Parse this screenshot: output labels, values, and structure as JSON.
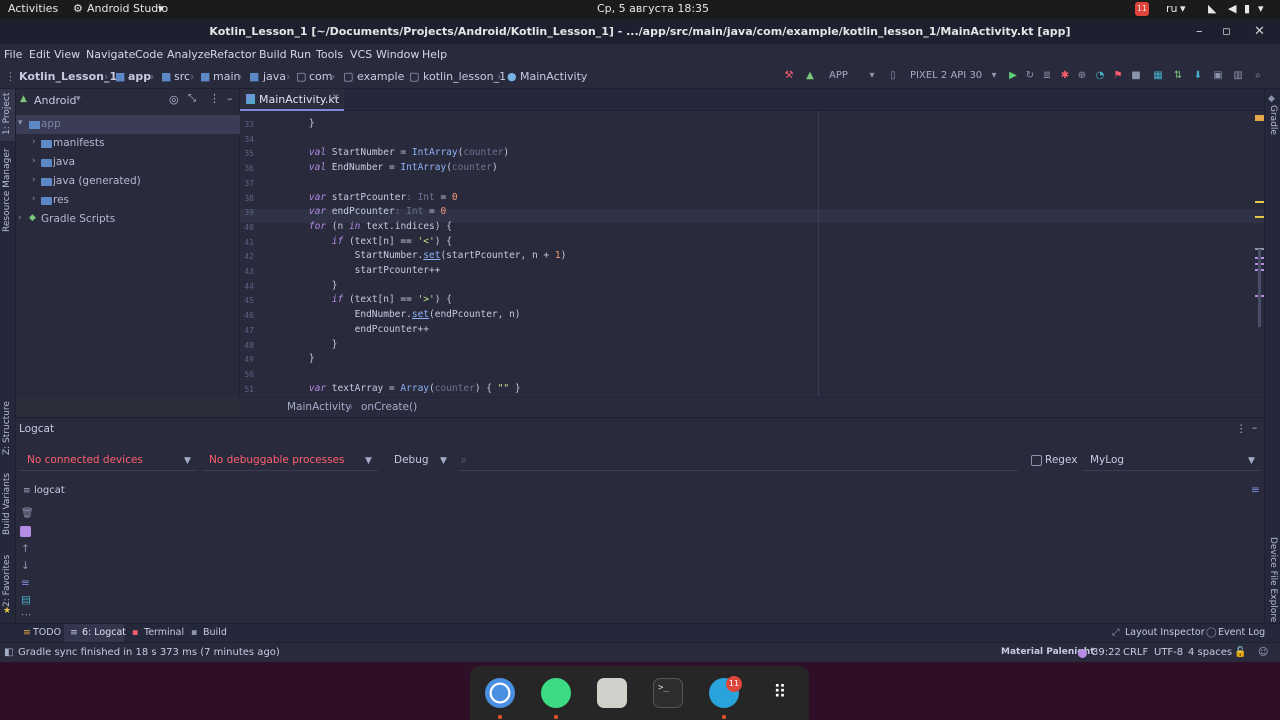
{
  "topbar": {
    "activities": "Activities",
    "app_name": "Android Studio",
    "clock": "Ср, 5 августа  18:35",
    "lang": "ru",
    "notif_count": "11"
  },
  "window": {
    "title": "Kotlin_Lesson_1 [~/Documents/Projects/Android/Kotlin_Lesson_1] - .../app/src/main/java/com/example/kotlin_lesson_1/MainActivity.kt [app]"
  },
  "menu": [
    "File",
    "Edit",
    "View",
    "Navigate",
    "Code",
    "Analyze",
    "Refactor",
    "Build",
    "Run",
    "Tools",
    "VCS",
    "Window",
    "Help"
  ],
  "breadcrumb": {
    "items": [
      "Kotlin_Lesson_1",
      "app",
      "src",
      "main",
      "java",
      "com",
      "example",
      "kotlin_lesson_1",
      "MainActivity"
    ]
  },
  "toolbar": {
    "config": "APP",
    "device": "PIXEL 2 API 30"
  },
  "project": {
    "view_mode": "Android",
    "tree": [
      {
        "label": "app"
      },
      {
        "label": "manifests"
      },
      {
        "label": "java"
      },
      {
        "label": "java (generated)"
      },
      {
        "label": "res"
      },
      {
        "label": "Gradle Scripts"
      }
    ]
  },
  "left_strip": {
    "project": "1: Project",
    "resource_manager": "Resource Manager",
    "structure": "Z: Structure",
    "build_variants": "Build Variants",
    "favorites": "2: Favorites"
  },
  "right_strip": {
    "gradle": "Gradle",
    "device_file_explorer": "Device File Explorer"
  },
  "editor": {
    "tab": "MainActivity.kt",
    "line_numbers": [
      "33",
      "34",
      "35",
      "36",
      "37",
      "38",
      "39",
      "40",
      "41",
      "42",
      "43",
      "44",
      "45",
      "46",
      "47",
      "48",
      "49",
      "50",
      "51"
    ],
    "lines": [
      {
        "t": "    }"
      },
      {
        "t": ""
      },
      {
        "t": "    val StartNumber = IntArray(counter)"
      },
      {
        "t": "    val EndNumber = IntArray(counter)"
      },
      {
        "t": ""
      },
      {
        "t": "    var startPcounter: Int = 0"
      },
      {
        "t": "    var endPcounter: Int = 0"
      },
      {
        "t": "    for (n in text.indices) {"
      },
      {
        "t": "        if (text[n] == '<') {"
      },
      {
        "t": "            StartNumber.set(startPcounter, n + 1)"
      },
      {
        "t": "            startPcounter++"
      },
      {
        "t": "        }"
      },
      {
        "t": "        if (text[n] == '>') {"
      },
      {
        "t": "            EndNumber.set(endPcounter, n)"
      },
      {
        "t": "            endPcounter++"
      },
      {
        "t": "        }"
      },
      {
        "t": "    }"
      },
      {
        "t": ""
      },
      {
        "t": "    var textArray = Array(counter) { \"\" }"
      }
    ],
    "crumb_class": "MainActivity",
    "crumb_method": "onCreate()"
  },
  "logcat": {
    "title": "Logcat",
    "device": "No connected devices",
    "process": "No debuggable processes",
    "level": "Debug",
    "regex": "Regex",
    "filter": "MyLog",
    "tree_label": "logcat"
  },
  "bottom_tabs": {
    "todo": "TODO",
    "logcat": "6: Logcat",
    "terminal": "Terminal",
    "build": "Build",
    "layout_inspector": "Layout Inspector",
    "event_log": "Event Log"
  },
  "status": {
    "message": "Gradle sync finished in 18 s 373 ms (7 minutes ago)",
    "theme": "Material Palenight",
    "position": "39:22",
    "line_sep": "CRLF",
    "encoding": "UTF-8",
    "indent": "4 spaces"
  },
  "dock": {
    "telegram_badge": "11"
  },
  "colors": {
    "accent": "#7c89d9",
    "editor_bg": "#292b3c",
    "error_red": "#ff5f6d",
    "desktop_bg": "#2f0e27"
  }
}
